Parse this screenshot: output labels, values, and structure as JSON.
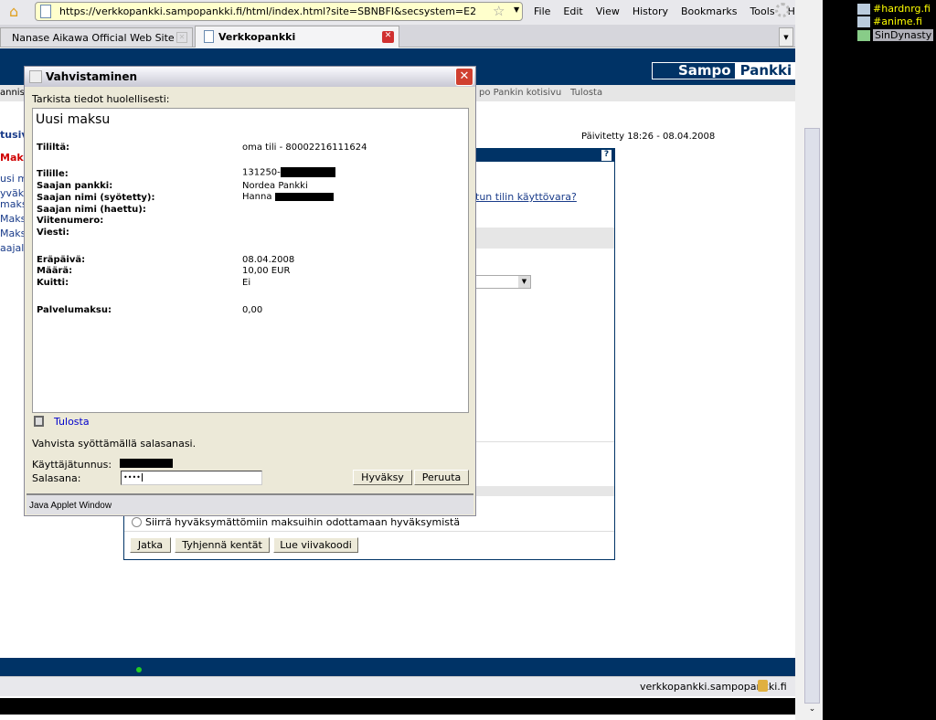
{
  "browser": {
    "url": "https://verkkopankki.sampopankki.fi/html/index.html?site=SBNBFI&secsystem=E2",
    "menu": [
      "File",
      "Edit",
      "View",
      "History",
      "Bookmarks",
      "Tools",
      "Help"
    ],
    "tabs": [
      {
        "label": "Nanase Aikawa Official Web Site",
        "active": false
      },
      {
        "label": "Verkkopankki",
        "active": true
      }
    ],
    "status_text": "verkkopankki.sampopankki.fi"
  },
  "side_panel": {
    "items": [
      "#hardnrg.fi",
      "#anime.fi",
      "SinDynasty"
    ]
  },
  "page": {
    "logo": {
      "left": "Sampo",
      "right": "Pankki"
    },
    "nav_links": [
      "po Pankin kotisivu",
      "Tulosta"
    ],
    "left_nav_fragment": "annis",
    "sidebar": [
      "tusiv",
      "Maksu",
      "usi m",
      "yväk",
      "maksu",
      "Maksu",
      "Maksu",
      "aajal"
    ],
    "updated": "Päivitetty 18:26 - 08.04.2008",
    "help": "?",
    "link_fragment": "tun tilin käyttövara?",
    "radio_label": "Siirrä hyväksymättömiin maksuihin odottamaan hyväksymistä",
    "buttons": [
      "Jatka",
      "Tyhjennä kentät",
      "Lue viivakoodi"
    ]
  },
  "dialog": {
    "title": "Vahvistaminen",
    "instruction": "Tarkista tiedot huolellisesti:",
    "heading": "Uusi maksu",
    "rows": [
      {
        "label": "Tililtä:",
        "value": "oma tili - 80002216111624"
      },
      {
        "label": "Tilille:",
        "value": "131250-"
      },
      {
        "label": "Saajan pankki:",
        "value": "Nordea Pankki"
      },
      {
        "label": "Saajan nimi (syötetty):",
        "value": "Hanna"
      },
      {
        "label": "Saajan nimi (haettu):",
        "value": ""
      },
      {
        "label": "Viitenumero:",
        "value": ""
      },
      {
        "label": "Viesti:",
        "value": ""
      },
      {
        "label": "Eräpäivä:",
        "value": "08.04.2008"
      },
      {
        "label": "Määrä:",
        "value": "10,00 EUR"
      },
      {
        "label": "Kuitti:",
        "value": "Ei"
      },
      {
        "label": "Palvelumaksu:",
        "value": "0,00"
      }
    ],
    "print_link": "Tulosta",
    "confirm_text": "Vahvista syöttämällä salasanasi.",
    "username_label": "Käyttäjätunnus:",
    "password_label": "Salasana:",
    "password_value": "••••",
    "accept": "Hyväksy",
    "cancel": "Peruuta",
    "footer": "Java Applet Window"
  },
  "colors": {
    "brand_blue": "#003366",
    "dialog_bg": "#ece9d8",
    "url_bg": "#ffffcc"
  }
}
